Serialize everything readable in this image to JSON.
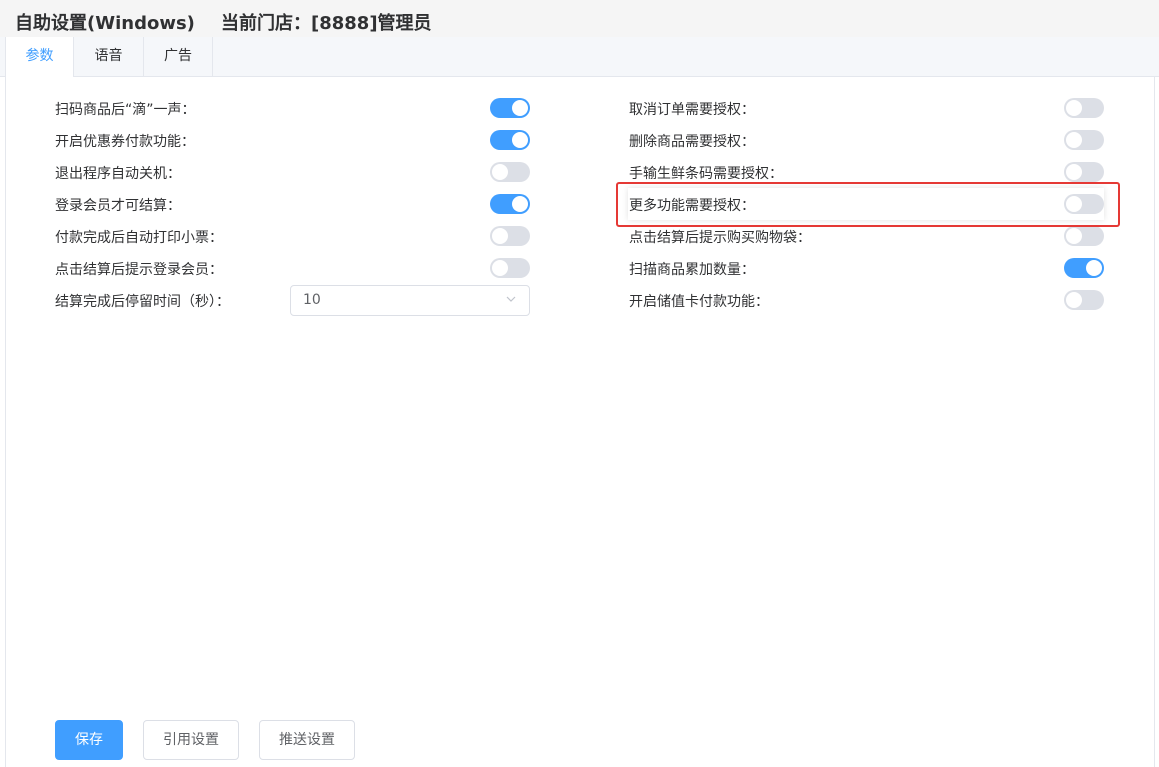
{
  "header": {
    "title": "自助设置(Windows)",
    "store": "当前门店：[8888]管理员"
  },
  "tabs": [
    {
      "label": "参数",
      "active": true
    },
    {
      "label": "语音",
      "active": false
    },
    {
      "label": "广告",
      "active": false
    }
  ],
  "left_settings": [
    {
      "label": "扫码商品后“滴”一声：",
      "on": true
    },
    {
      "label": "开启优惠券付款功能：",
      "on": true
    },
    {
      "label": "退出程序自动关机：",
      "on": false
    },
    {
      "label": "登录会员才可结算：",
      "on": true
    },
    {
      "label": "付款完成后自动打印小票：",
      "on": false
    },
    {
      "label": "点击结算后提示登录会员：",
      "on": false
    }
  ],
  "stay_time": {
    "label": "结算完成后停留时间（秒）：",
    "value": "10"
  },
  "right_settings": [
    {
      "label": "取消订单需要授权：",
      "on": false
    },
    {
      "label": "删除商品需要授权：",
      "on": false
    },
    {
      "label": "手输生鲜条码需要授权：",
      "on": false
    },
    {
      "label": "更多功能需要授权：",
      "on": false
    },
    {
      "label": "点击结算后提示购买购物袋：",
      "on": false
    },
    {
      "label": "扫描商品累加数量：",
      "on": true
    },
    {
      "label": "开启储值卡付款功能：",
      "on": false
    }
  ],
  "buttons": {
    "save": "保存",
    "use_settings": "引用设置",
    "push_settings": "推送设置"
  },
  "colors": {
    "accent": "#409eff",
    "switch_off": "#dcdfe6",
    "annotation": "#e53935"
  }
}
